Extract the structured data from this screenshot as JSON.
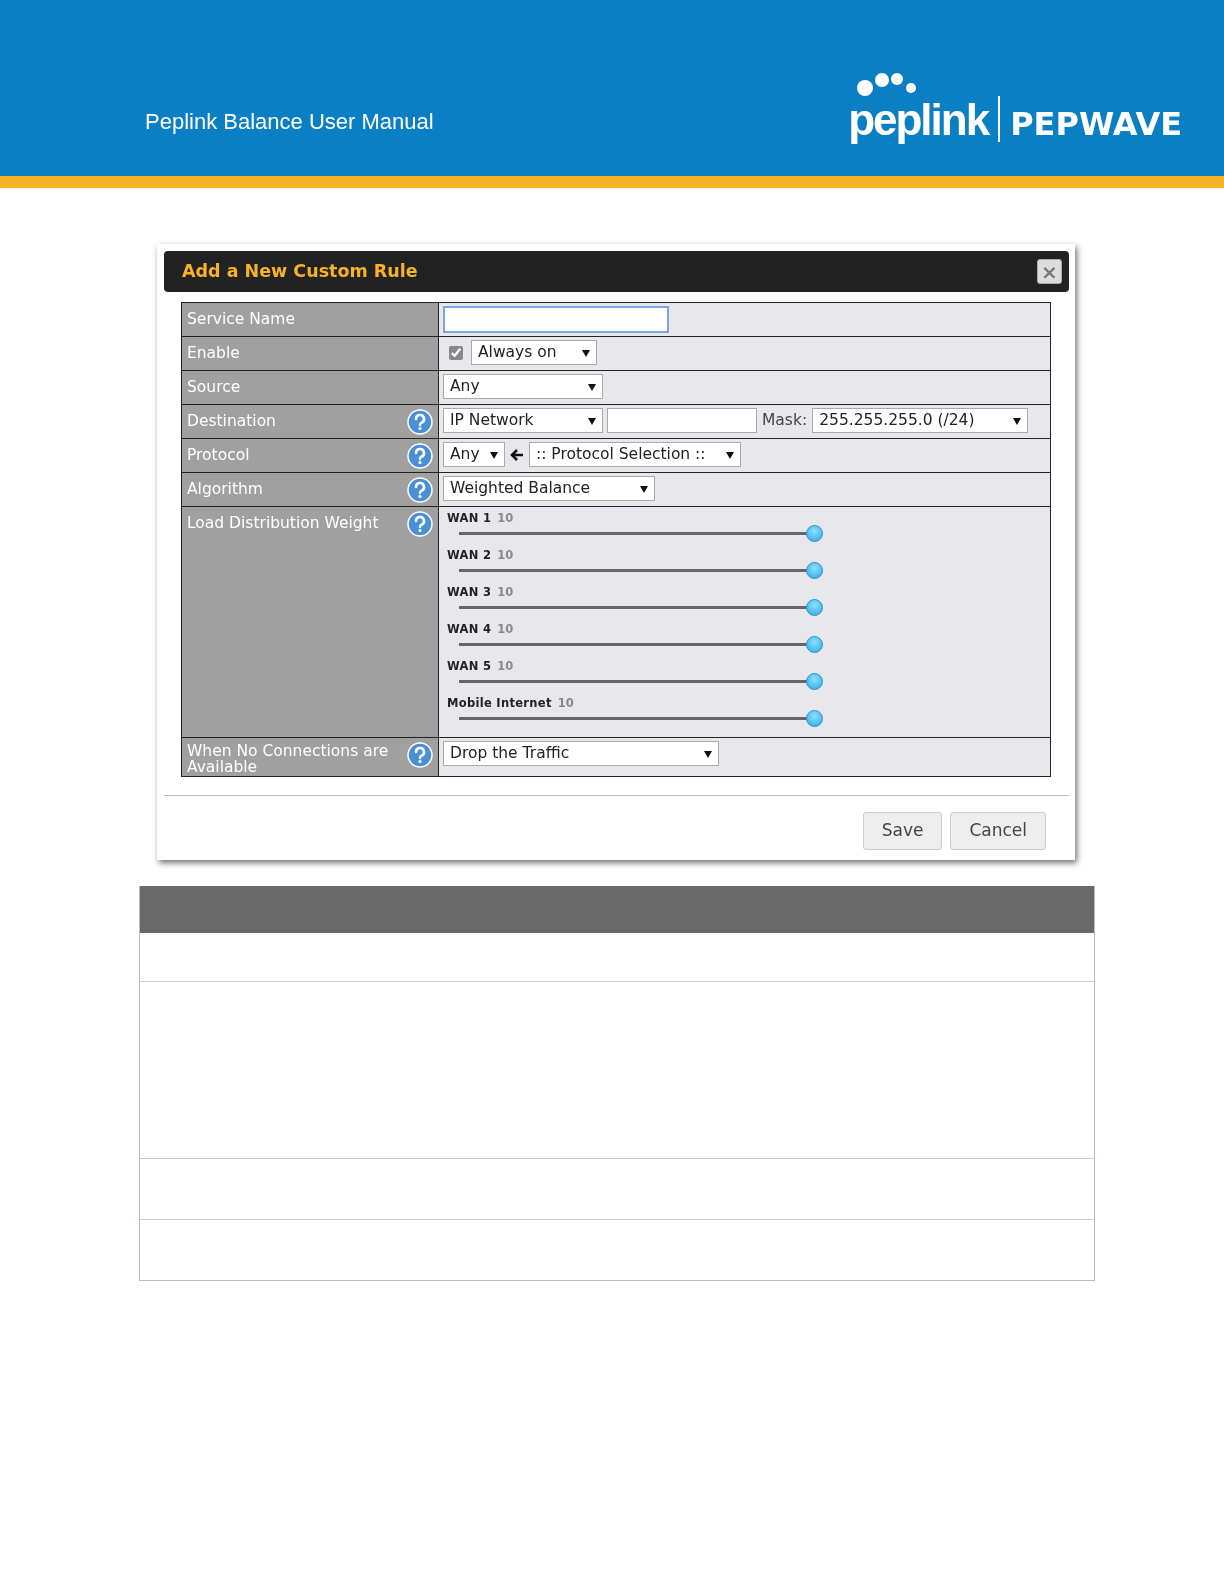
{
  "page_header": {
    "title": "Peplink Balance User Manual",
    "logo_left": "peplink",
    "logo_right": "PEPWAVE"
  },
  "dialog": {
    "title": "Add a New Custom Rule",
    "close": "×",
    "rows": [
      {
        "label": "Service Name",
        "help": false,
        "kind": "text",
        "focused": true
      },
      {
        "label": "Enable",
        "help": false,
        "kind": "enable",
        "checked": true,
        "select": "Always on"
      },
      {
        "label": "Source",
        "help": false,
        "kind": "select",
        "select": "Any"
      },
      {
        "label": "Destination",
        "help": true,
        "kind": "destination",
        "select": "IP Network",
        "mask_label": "Mask:",
        "mask": "255.255.255.0 (/24)"
      },
      {
        "label": "Protocol",
        "help": true,
        "kind": "protocol",
        "select": "Any",
        "select2": ":: Protocol Selection ::"
      },
      {
        "label": "Algorithm",
        "help": true,
        "kind": "select",
        "select": "Weighted Balance"
      },
      {
        "label": "Load Distribution Weight",
        "help": true,
        "kind": "sliders",
        "sliders": [
          {
            "name": "WAN 1",
            "value": "10",
            "level": 1
          },
          {
            "name": "WAN 2",
            "value": "10",
            "level": 1
          },
          {
            "name": "WAN 3",
            "value": "10",
            "level": 1
          },
          {
            "name": "WAN 4",
            "value": "10",
            "level": 1
          },
          {
            "name": "WAN 5",
            "value": "10",
            "level": 1
          },
          {
            "name": "Mobile Internet",
            "value": "10",
            "level": 1
          }
        ]
      },
      {
        "label": "When No Connections are Available",
        "help": true,
        "kind": "select",
        "select": "Drop the Traffic"
      }
    ],
    "buttons": [
      "Save",
      "Cancel"
    ]
  }
}
